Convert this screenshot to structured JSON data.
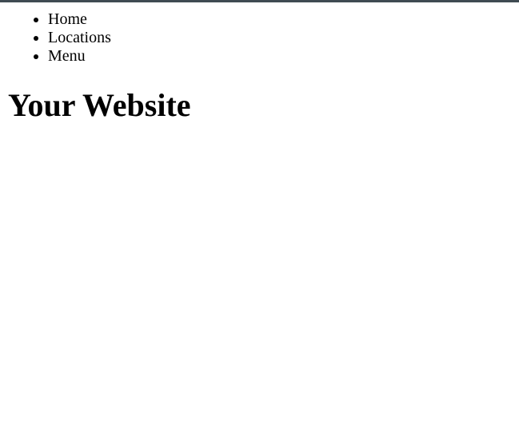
{
  "colors": {
    "top_rule": "#3f4b52",
    "text": "#000000",
    "background": "#ffffff"
  },
  "nav": {
    "items": [
      {
        "label": "Home"
      },
      {
        "label": "Locations"
      },
      {
        "label": "Menu"
      }
    ]
  },
  "header": {
    "title": "Your Website"
  }
}
